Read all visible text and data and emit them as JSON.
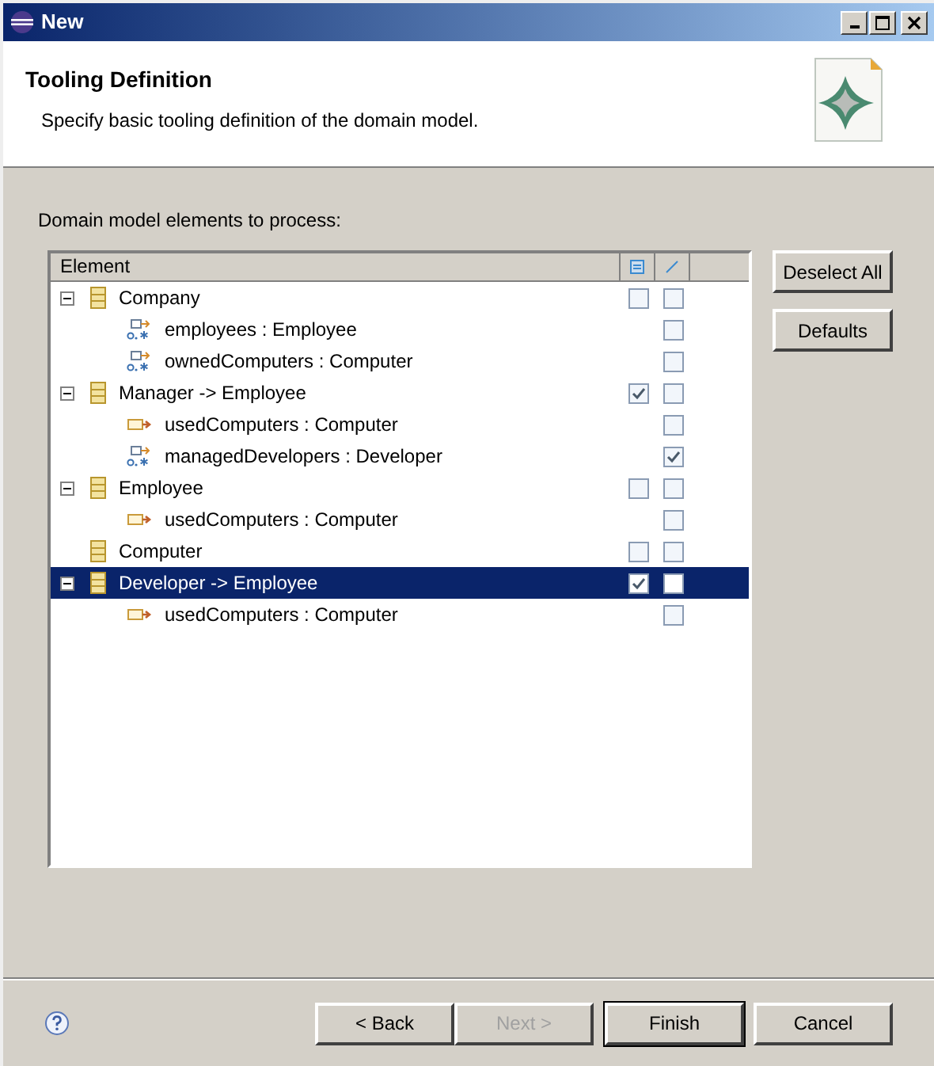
{
  "window": {
    "title": "New"
  },
  "header": {
    "title": "Tooling Definition",
    "description": "Specify basic tooling definition of the domain model."
  },
  "section_label": "Domain model elements to process:",
  "table": {
    "columns": [
      "Element"
    ],
    "tree": [
      {
        "kind": "class",
        "label": "Company",
        "expanded": true,
        "selected": false,
        "col_1_checked": false,
        "col_2_checked": false,
        "children": [
          {
            "kind": "many",
            "label": "employees : Employee",
            "col_2_checked": false
          },
          {
            "kind": "many",
            "label": "ownedComputers : Computer",
            "col_2_checked": false
          }
        ]
      },
      {
        "kind": "class",
        "label": "Manager -> Employee",
        "expanded": true,
        "selected": false,
        "col_1_checked": true,
        "col_2_checked": false,
        "children": [
          {
            "kind": "ref",
            "label": "usedComputers : Computer",
            "col_2_checked": false
          },
          {
            "kind": "many",
            "label": "managedDevelopers : Developer",
            "col_2_checked": true
          }
        ]
      },
      {
        "kind": "class",
        "label": "Employee",
        "expanded": true,
        "selected": false,
        "col_1_checked": false,
        "col_2_checked": false,
        "children": [
          {
            "kind": "ref",
            "label": "usedComputers : Computer",
            "col_2_checked": false
          }
        ]
      },
      {
        "kind": "class",
        "label": "Computer",
        "selected": false,
        "col_1_checked": false,
        "col_2_checked": false
      },
      {
        "kind": "class",
        "label": "Developer -> Employee",
        "expanded": true,
        "selected": true,
        "col_1_checked": true,
        "col_2_checked": false,
        "children": [
          {
            "kind": "ref",
            "label": "usedComputers : Computer",
            "col_2_checked": false
          }
        ]
      }
    ]
  },
  "side_buttons": [
    "Deselect All",
    "Defaults"
  ],
  "footer_buttons": [
    {
      "label": "< Back",
      "disabled": false,
      "default": false
    },
    {
      "label": "Next >",
      "disabled": true,
      "default": false
    },
    {
      "label": "Finish",
      "disabled": false,
      "default": true
    },
    {
      "label": "Cancel",
      "disabled": false,
      "default": false
    }
  ]
}
